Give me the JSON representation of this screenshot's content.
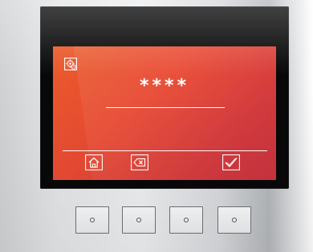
{
  "screen": {
    "password_mask": "****",
    "header_icon": "settings-lock-icon"
  },
  "softkeys": [
    {
      "icon": "home-icon"
    },
    {
      "icon": "backspace-icon"
    },
    {
      "icon": "confirm-check-icon"
    }
  ],
  "hardware_buttons": [
    {
      "icon": "indicator-dot-icon"
    },
    {
      "icon": "indicator-dot-icon"
    },
    {
      "icon": "indicator-dot-icon"
    },
    {
      "icon": "indicator-dot-icon"
    }
  ],
  "colors": {
    "screen_gradient_start": "#ea5b2a",
    "screen_gradient_end": "#c93340",
    "screen_foreground": "#ffffff",
    "bezel": "#080808",
    "housing": "#e3e5e7"
  }
}
